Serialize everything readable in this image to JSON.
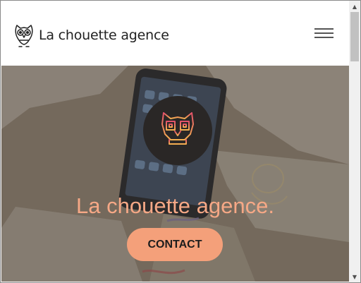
{
  "header": {
    "brand": "La chouette agence",
    "logo_icon": "owl-logo-icon",
    "menu_icon": "hamburger-menu-icon"
  },
  "hero": {
    "title": "La chouette agence.",
    "contact_label": "CONTACT",
    "emblem_icon": "owl-emblem-icon",
    "colors": {
      "title": "#f6a886",
      "button": "#f4a07a",
      "overlay": "#6f6457",
      "emblem_bg": "#2a2726"
    }
  },
  "scrollbar": {
    "up_icon": "scroll-up-arrow-icon",
    "down_icon": "scroll-down-arrow-icon"
  }
}
